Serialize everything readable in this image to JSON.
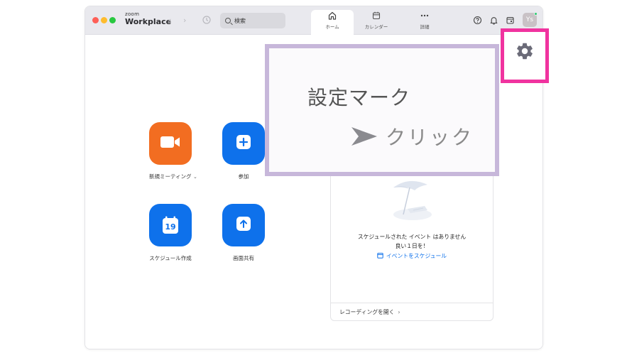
{
  "app": {
    "logo_small": "zoom",
    "logo_large": "Workplace"
  },
  "search": {
    "label": "検索"
  },
  "tabs": [
    {
      "label": "ホーム",
      "icon": "home-icon"
    },
    {
      "label": "カレンダー",
      "icon": "calendar-icon"
    },
    {
      "label": "詳細",
      "icon": "more-dots-icon"
    }
  ],
  "header_icons": [
    "help-icon",
    "bell-icon",
    "calendar-note-icon"
  ],
  "avatar": {
    "initials": "Ys",
    "status_color": "#2ecc71"
  },
  "actions": [
    {
      "label": "新規ミーティング",
      "color": "#f26d21",
      "icon": "video-camera-icon"
    },
    {
      "label": "参加",
      "color": "#0e71eb",
      "icon": "plus-icon"
    },
    {
      "label": "スケジュール作成",
      "color": "#0e71eb",
      "icon": "calendar-19-icon",
      "icon_text": "19"
    },
    {
      "label": "画面共有",
      "color": "#0e71eb",
      "icon": "share-up-arrow-icon"
    }
  ],
  "panel": {
    "no_events_line1": "スケジュールされた イベント はありません",
    "no_events_line2": "良い１日を！",
    "schedule_link": "イベントをスケジュール",
    "recordings_link": "レコーディングを開く"
  },
  "callout": {
    "title": "設定マーク",
    "action": "クリック",
    "border_color": "#c7b7da"
  },
  "highlight": {
    "target": "gear-icon",
    "border_color": "#f0339f"
  }
}
